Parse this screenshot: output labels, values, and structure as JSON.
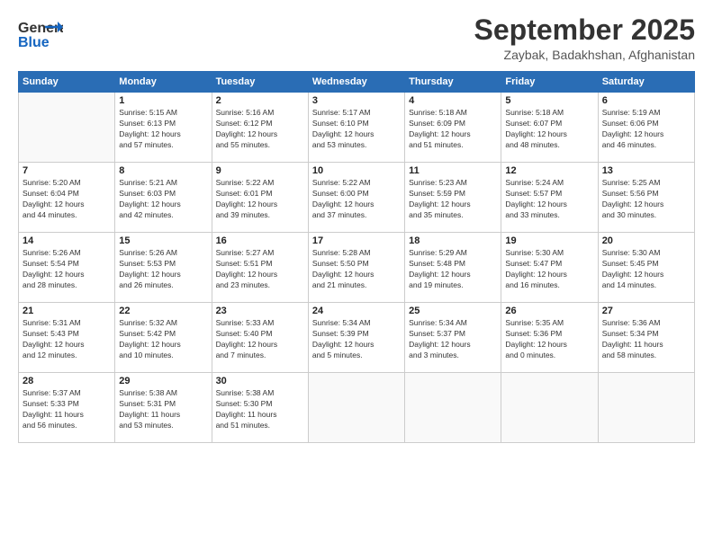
{
  "header": {
    "logo_general": "General",
    "logo_blue": "Blue",
    "month": "September 2025",
    "location": "Zaybak, Badakhshan, Afghanistan"
  },
  "weekdays": [
    "Sunday",
    "Monday",
    "Tuesday",
    "Wednesday",
    "Thursday",
    "Friday",
    "Saturday"
  ],
  "weeks": [
    [
      {
        "day": "",
        "info": ""
      },
      {
        "day": "1",
        "info": "Sunrise: 5:15 AM\nSunset: 6:13 PM\nDaylight: 12 hours\nand 57 minutes."
      },
      {
        "day": "2",
        "info": "Sunrise: 5:16 AM\nSunset: 6:12 PM\nDaylight: 12 hours\nand 55 minutes."
      },
      {
        "day": "3",
        "info": "Sunrise: 5:17 AM\nSunset: 6:10 PM\nDaylight: 12 hours\nand 53 minutes."
      },
      {
        "day": "4",
        "info": "Sunrise: 5:18 AM\nSunset: 6:09 PM\nDaylight: 12 hours\nand 51 minutes."
      },
      {
        "day": "5",
        "info": "Sunrise: 5:18 AM\nSunset: 6:07 PM\nDaylight: 12 hours\nand 48 minutes."
      },
      {
        "day": "6",
        "info": "Sunrise: 5:19 AM\nSunset: 6:06 PM\nDaylight: 12 hours\nand 46 minutes."
      }
    ],
    [
      {
        "day": "7",
        "info": "Sunrise: 5:20 AM\nSunset: 6:04 PM\nDaylight: 12 hours\nand 44 minutes."
      },
      {
        "day": "8",
        "info": "Sunrise: 5:21 AM\nSunset: 6:03 PM\nDaylight: 12 hours\nand 42 minutes."
      },
      {
        "day": "9",
        "info": "Sunrise: 5:22 AM\nSunset: 6:01 PM\nDaylight: 12 hours\nand 39 minutes."
      },
      {
        "day": "10",
        "info": "Sunrise: 5:22 AM\nSunset: 6:00 PM\nDaylight: 12 hours\nand 37 minutes."
      },
      {
        "day": "11",
        "info": "Sunrise: 5:23 AM\nSunset: 5:59 PM\nDaylight: 12 hours\nand 35 minutes."
      },
      {
        "day": "12",
        "info": "Sunrise: 5:24 AM\nSunset: 5:57 PM\nDaylight: 12 hours\nand 33 minutes."
      },
      {
        "day": "13",
        "info": "Sunrise: 5:25 AM\nSunset: 5:56 PM\nDaylight: 12 hours\nand 30 minutes."
      }
    ],
    [
      {
        "day": "14",
        "info": "Sunrise: 5:26 AM\nSunset: 5:54 PM\nDaylight: 12 hours\nand 28 minutes."
      },
      {
        "day": "15",
        "info": "Sunrise: 5:26 AM\nSunset: 5:53 PM\nDaylight: 12 hours\nand 26 minutes."
      },
      {
        "day": "16",
        "info": "Sunrise: 5:27 AM\nSunset: 5:51 PM\nDaylight: 12 hours\nand 23 minutes."
      },
      {
        "day": "17",
        "info": "Sunrise: 5:28 AM\nSunset: 5:50 PM\nDaylight: 12 hours\nand 21 minutes."
      },
      {
        "day": "18",
        "info": "Sunrise: 5:29 AM\nSunset: 5:48 PM\nDaylight: 12 hours\nand 19 minutes."
      },
      {
        "day": "19",
        "info": "Sunrise: 5:30 AM\nSunset: 5:47 PM\nDaylight: 12 hours\nand 16 minutes."
      },
      {
        "day": "20",
        "info": "Sunrise: 5:30 AM\nSunset: 5:45 PM\nDaylight: 12 hours\nand 14 minutes."
      }
    ],
    [
      {
        "day": "21",
        "info": "Sunrise: 5:31 AM\nSunset: 5:43 PM\nDaylight: 12 hours\nand 12 minutes."
      },
      {
        "day": "22",
        "info": "Sunrise: 5:32 AM\nSunset: 5:42 PM\nDaylight: 12 hours\nand 10 minutes."
      },
      {
        "day": "23",
        "info": "Sunrise: 5:33 AM\nSunset: 5:40 PM\nDaylight: 12 hours\nand 7 minutes."
      },
      {
        "day": "24",
        "info": "Sunrise: 5:34 AM\nSunset: 5:39 PM\nDaylight: 12 hours\nand 5 minutes."
      },
      {
        "day": "25",
        "info": "Sunrise: 5:34 AM\nSunset: 5:37 PM\nDaylight: 12 hours\nand 3 minutes."
      },
      {
        "day": "26",
        "info": "Sunrise: 5:35 AM\nSunset: 5:36 PM\nDaylight: 12 hours\nand 0 minutes."
      },
      {
        "day": "27",
        "info": "Sunrise: 5:36 AM\nSunset: 5:34 PM\nDaylight: 11 hours\nand 58 minutes."
      }
    ],
    [
      {
        "day": "28",
        "info": "Sunrise: 5:37 AM\nSunset: 5:33 PM\nDaylight: 11 hours\nand 56 minutes."
      },
      {
        "day": "29",
        "info": "Sunrise: 5:38 AM\nSunset: 5:31 PM\nDaylight: 11 hours\nand 53 minutes."
      },
      {
        "day": "30",
        "info": "Sunrise: 5:38 AM\nSunset: 5:30 PM\nDaylight: 11 hours\nand 51 minutes."
      },
      {
        "day": "",
        "info": ""
      },
      {
        "day": "",
        "info": ""
      },
      {
        "day": "",
        "info": ""
      },
      {
        "day": "",
        "info": ""
      }
    ]
  ]
}
